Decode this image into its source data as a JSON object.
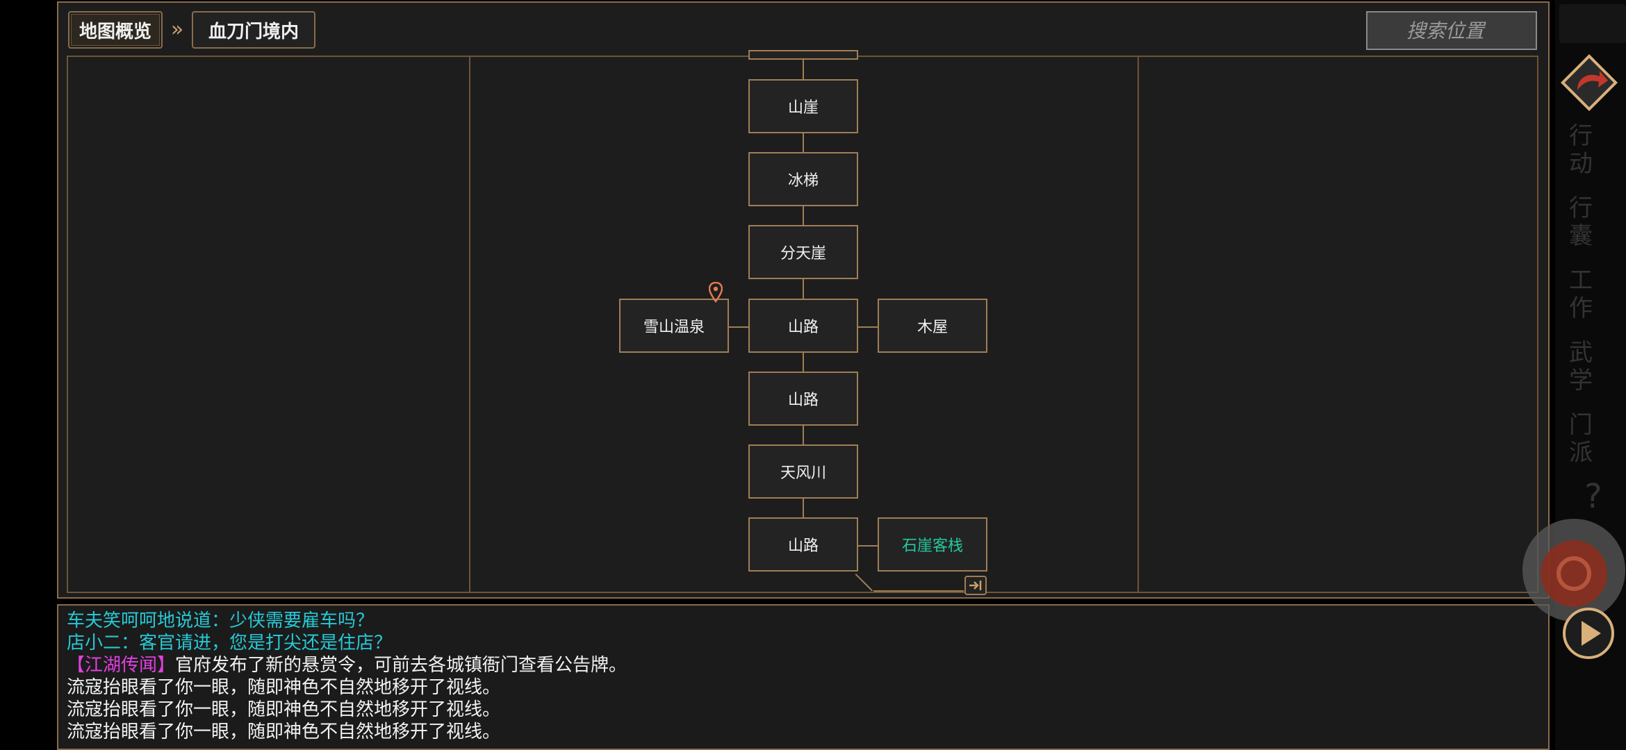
{
  "breadcrumb": {
    "overview": "地图概览",
    "separator": "»",
    "current": "血刀门境内"
  },
  "search": {
    "placeholder": "搜索位置"
  },
  "map": {
    "nodes": {
      "n1": "山崖",
      "n2": "冰梯",
      "n3": "分天崖",
      "n4": "山路",
      "n5": "雪山温泉",
      "n6": "木屋",
      "n7": "山路",
      "n8": "天风川",
      "n9": "山路",
      "n10": "石崖客栈"
    }
  },
  "log": [
    {
      "text": "车夫笑呵呵地说道：少侠需要雇车吗？"
    },
    {
      "text": "店小二：客官请进，您是打尖还是住店？"
    },
    {
      "tag": "【江湖传闻】",
      "text": "官府发布了新的悬赏令，可前去各城镇衙门查看公告牌。"
    },
    {
      "text": "流寇抬眼看了你一眼，随即神色不自然地移开了视线。"
    },
    {
      "text": "流寇抬眼看了你一眼，随即神色不自然地移开了视线。"
    },
    {
      "text": "流寇抬眼看了你一眼，随即神色不自然地移开了视线。"
    }
  ],
  "sidebar": {
    "help": "?",
    "act": "行动",
    "bag": "行囊",
    "work": "工作",
    "skill": "武学",
    "sect": "门派"
  },
  "colors": {
    "border": "#8a6c4a",
    "teal": "#26c9d6",
    "highlight": "#24c8a0",
    "rumor": "#e040e0",
    "back": "#c0392b"
  }
}
